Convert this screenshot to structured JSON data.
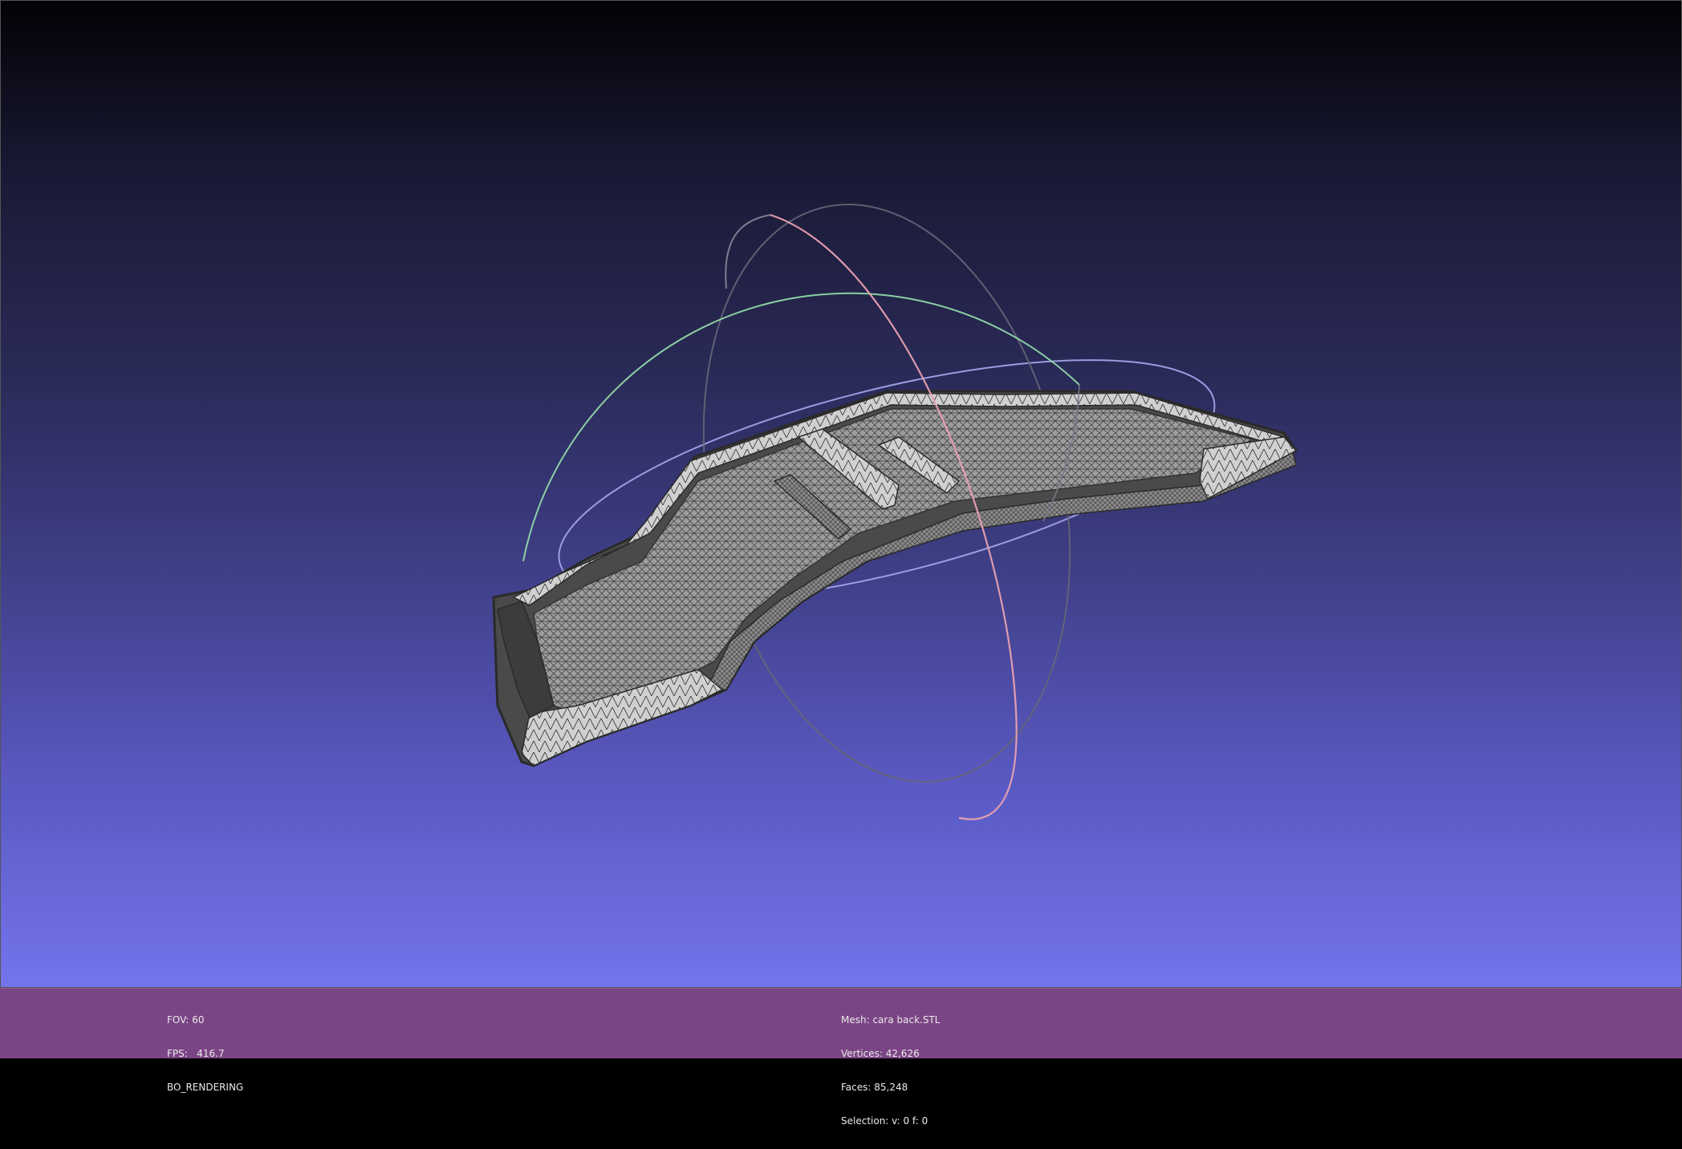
{
  "viewer": {
    "background_top_color": "#020206",
    "background_bottom_color": "#7474ec",
    "mesh_color": "#9a9a9a",
    "wire_color": "#333333",
    "trackball_colors": {
      "x_ring": "#e8a0b0",
      "y_ring": "#90d8a8",
      "z_ring": "#a8a8f0"
    }
  },
  "statusbar": {
    "color": "#7b4585",
    "left": {
      "fov": "FOV: 60",
      "fps": "FPS:   416.7",
      "mode": "BO_RENDERING"
    },
    "center": {
      "mesh": "Mesh: cara back.STL",
      "vertices": "Vertices: 42,626",
      "faces": "Faces: 85,248",
      "selection": "Selection: v: 0 f: 0"
    }
  }
}
